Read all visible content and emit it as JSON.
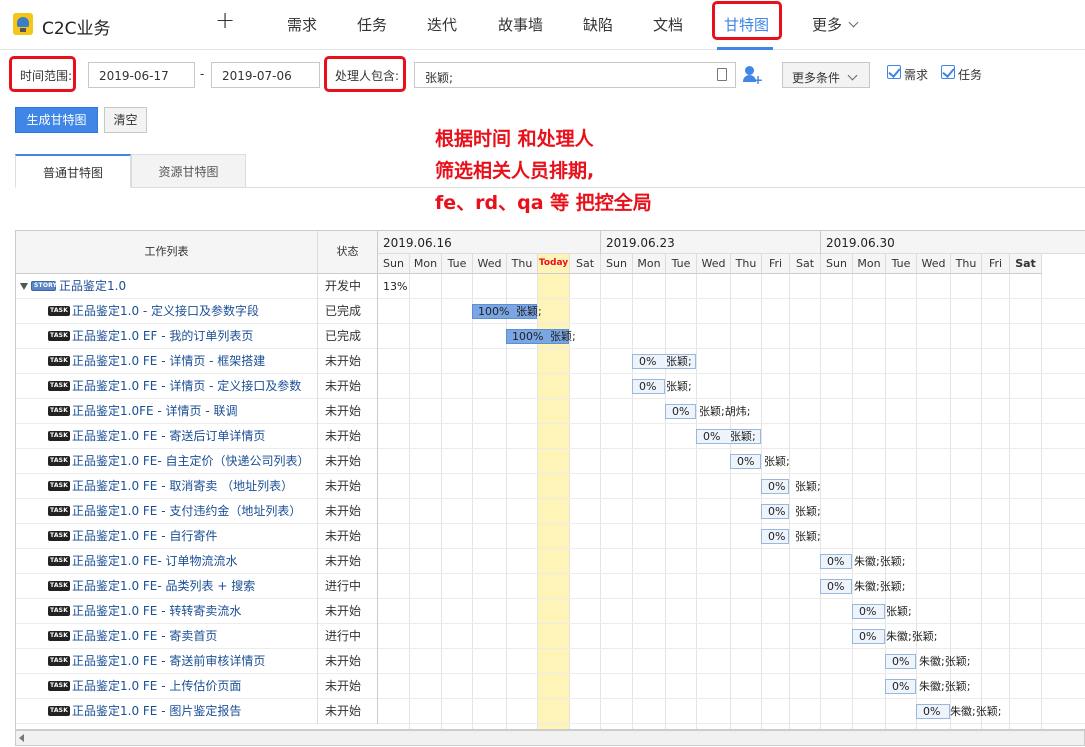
{
  "app": {
    "title": "C2C业务"
  },
  "nav": {
    "plus": "+",
    "items": [
      "需求",
      "任务",
      "迭代",
      "故事墙",
      "缺陷",
      "文档",
      "甘特图",
      "更多"
    ]
  },
  "filters": {
    "time_label": "时间范围:",
    "date_start": "2019-06-17",
    "date_sep": "-",
    "date_end": "2019-07-06",
    "handler_label": "处理人包含:",
    "handler_value": "张颖;",
    "more_conditions": "更多条件",
    "cb_requirement": "需求",
    "cb_task": "任务"
  },
  "actions": {
    "generate": "生成甘特图",
    "clear": "清空"
  },
  "annotation": {
    "line1": "根据时间 和处理人",
    "line2": "筛选相关人员排期,",
    "line3": "fe、rd、qa 等 把控全局"
  },
  "tabs": {
    "normal": "普通甘特图",
    "resource": "资源甘特图"
  },
  "gantt": {
    "col_work": "工作列表",
    "col_status": "状态",
    "weeks": [
      "2019.06.16",
      "2019.06.23",
      "2019.06.30"
    ],
    "days": [
      "Sun",
      "Mon",
      "Tue",
      "Wed",
      "Thu",
      "Today",
      "Sat",
      "Sun",
      "Mon",
      "Tue",
      "Wed",
      "Thu",
      "Fri",
      "Sat",
      "Sun",
      "Mon",
      "Tue",
      "Wed",
      "Thu",
      "Fri",
      "Sat"
    ],
    "tags": {
      "story": "STORY",
      "task": "TASK"
    },
    "rows": [
      {
        "type": "story",
        "title": "正品鉴定1.0",
        "status": "开发中",
        "label": "13%",
        "start": 0,
        "span": 0
      },
      {
        "type": "task",
        "title": "正品鉴定1.0 - 定义接口及参数字段",
        "status": "已完成",
        "pct": "100%",
        "assignee": "张颖;",
        "start": 3,
        "span": 2,
        "done": true
      },
      {
        "type": "task",
        "title": "正品鉴定1.0 EF - 我的订单列表页",
        "status": "已完成",
        "pct": "100%",
        "assignee": "张颖;",
        "start": 4,
        "span": 2,
        "done": true
      },
      {
        "type": "task",
        "title": "正品鉴定1.0 FE - 详情页 - 框架搭建",
        "status": "未开始",
        "pct": "0%",
        "assignee": "张颖;",
        "start": 8,
        "span": 2
      },
      {
        "type": "task",
        "title": "正品鉴定1.0 FE - 详情页 - 定义接口及参数",
        "status": "未开始",
        "pct": "0%",
        "assignee": "张颖;",
        "start": 8,
        "span": 1
      },
      {
        "type": "task",
        "title": "正品鉴定1.0FE - 详情页 - 联调",
        "status": "未开始",
        "pct": "0%",
        "assignee": "张颖;胡炜;",
        "start": 9,
        "span": 1
      },
      {
        "type": "task",
        "title": "正品鉴定1.0 FE - 寄送后订单详情页",
        "status": "未开始",
        "pct": "0%",
        "assignee": "张颖;",
        "start": 10,
        "span": 2
      },
      {
        "type": "task",
        "title": "正品鉴定1.0 FE- 自主定价（快递公司列表）",
        "status": "未开始",
        "pct": "0%",
        "assignee": "张颖;",
        "start": 11,
        "span": 1
      },
      {
        "type": "task",
        "title": "正品鉴定1.0 FE - 取消寄卖 （地址列表）",
        "status": "未开始",
        "pct": "0%",
        "assignee": "张颖;",
        "start": 12,
        "span": 1
      },
      {
        "type": "task",
        "title": "正品鉴定1.0 FE - 支付违约金（地址列表）",
        "status": "未开始",
        "pct": "0%",
        "assignee": "张颖;",
        "start": 12,
        "span": 1
      },
      {
        "type": "task",
        "title": "正品鉴定1.0 FE - 自行寄件",
        "status": "未开始",
        "pct": "0%",
        "assignee": "张颖;",
        "start": 12,
        "span": 1
      },
      {
        "type": "task",
        "title": "正品鉴定1.0 FE- 订单物流流水",
        "status": "未开始",
        "pct": "0%",
        "assignee": "朱徽;张颖;",
        "start": 14,
        "span": 1
      },
      {
        "type": "task",
        "title": "正品鉴定1.0 FE- 品类列表 + 搜索",
        "status": "进行中",
        "pct": "0%",
        "assignee": "朱徽;张颖;",
        "start": 14,
        "span": 1
      },
      {
        "type": "task",
        "title": "正品鉴定1.0 FE - 转转寄卖流水",
        "status": "未开始",
        "pct": "0%",
        "assignee": "张颖;",
        "start": 15,
        "span": 1
      },
      {
        "type": "task",
        "title": "正品鉴定1.0 FE - 寄卖首页",
        "status": "进行中",
        "pct": "0%",
        "assignee": "朱徽;张颖;",
        "start": 15,
        "span": 1
      },
      {
        "type": "task",
        "title": "正品鉴定1.0 FE - 寄送前审核详情页",
        "status": "未开始",
        "pct": "0%",
        "assignee": "朱徽;张颖;",
        "start": 16,
        "span": 1
      },
      {
        "type": "task",
        "title": "正品鉴定1.0 FE - 上传估价页面",
        "status": "未开始",
        "pct": "0%",
        "assignee": "朱徽;张颖;",
        "start": 16,
        "span": 1
      },
      {
        "type": "task",
        "title": "正品鉴定1.0 FE - 图片鉴定报告",
        "status": "未开始",
        "pct": "0%",
        "assignee": "朱徽;张颖;",
        "start": 17,
        "span": 1
      }
    ]
  }
}
